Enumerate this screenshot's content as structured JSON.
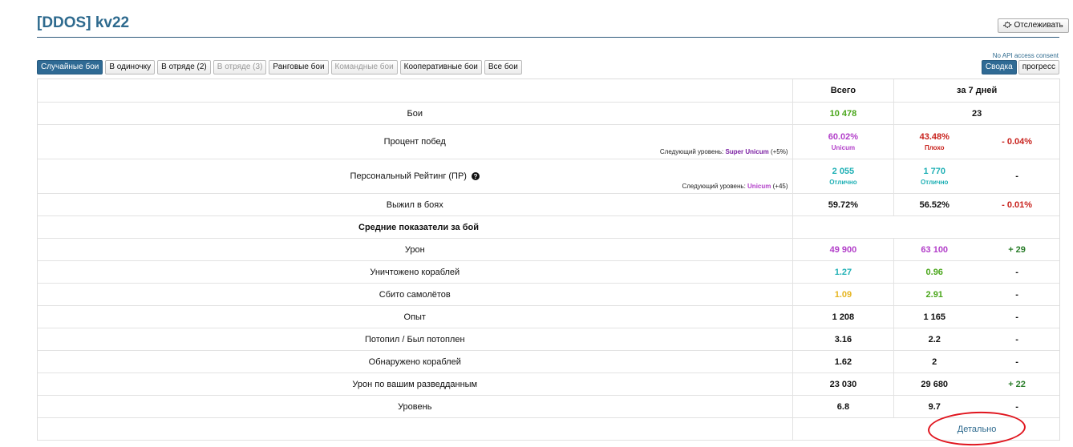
{
  "header": {
    "player_name": "[DDOS] kv22",
    "track_button": "Отслеживать",
    "api_note": "No API access consent"
  },
  "tabs": [
    {
      "label": "Случайные бои",
      "state": "active"
    },
    {
      "label": "В одиночку",
      "state": "normal"
    },
    {
      "label": "В отряде (2)",
      "state": "normal"
    },
    {
      "label": "В отряде (3)",
      "state": "disabled"
    },
    {
      "label": "Ранговые бои",
      "state": "normal"
    },
    {
      "label": "Командные бои",
      "state": "disabled"
    },
    {
      "label": "Кооперативные бои",
      "state": "normal"
    },
    {
      "label": "Все бои",
      "state": "normal"
    }
  ],
  "mode_tabs": [
    {
      "label": "Сводка",
      "state": "active"
    },
    {
      "label": "прогресс",
      "state": "normal"
    }
  ],
  "columns": {
    "total": "Всего",
    "week": "за 7 дней"
  },
  "colors": {
    "green": "#4aa61b",
    "purple": "#b23fc9",
    "red": "#c8221d",
    "teal": "#1fb0b5",
    "yellow": "#e6b520",
    "dark_green": "#2a7d2a",
    "link": "#2e6a8e",
    "dark_purple": "#7a1fa2"
  },
  "rows": [
    {
      "label": "Бои",
      "total": "10 478",
      "total_color": "#4aa61b",
      "week": "23",
      "week_color": "#111",
      "diff": "",
      "merged": true
    },
    {
      "label": "Процент побед",
      "total": "60.02%",
      "total_color": "#b23fc9",
      "total_sub": "Unicum",
      "week": "43.48%",
      "week_color": "#c8221d",
      "week_sub": "Плохо",
      "diff": "- 0.04%",
      "diff_color": "#c8221d",
      "next_prefix": "Следующий уровень:",
      "next_level": "Super Unicum",
      "next_level_color": "#7a1fa2",
      "next_suffix": "(+5%)",
      "tall": true
    },
    {
      "label": "Персональный Рейтинг (ПР)",
      "help": true,
      "total": "2 055",
      "total_color": "#1fb0b5",
      "total_sub": "Отлично",
      "week": "1 770",
      "week_color": "#1fb0b5",
      "week_sub": "Отлично",
      "diff": "-",
      "diff_color": "#111",
      "next_prefix": "Следующий уровень:",
      "next_level": "Unicum",
      "next_level_color": "#b23fc9",
      "next_suffix": "(+45)",
      "tall": true
    },
    {
      "label": "Выжил в боях",
      "total": "59.72%",
      "total_color": "#111",
      "week": "56.52%",
      "week_color": "#111",
      "diff": "- 0.01%",
      "diff_color": "#c8221d"
    },
    {
      "label": "Средние показатели за бой",
      "section": true
    },
    {
      "label": "Урон",
      "total": "49 900",
      "total_color": "#b23fc9",
      "week": "63 100",
      "week_color": "#b23fc9",
      "diff": "+ 29",
      "diff_color": "#2a7d2a"
    },
    {
      "label": "Уничтожено кораблей",
      "total": "1.27",
      "total_color": "#1fb0b5",
      "week": "0.96",
      "week_color": "#4aa61b",
      "diff": "-",
      "diff_color": "#111"
    },
    {
      "label": "Сбито самолётов",
      "total": "1.09",
      "total_color": "#e6b520",
      "week": "2.91",
      "week_color": "#4aa61b",
      "diff": "-",
      "diff_color": "#111"
    },
    {
      "label": "Опыт",
      "total": "1 208",
      "total_color": "#111",
      "week": "1 165",
      "week_color": "#111",
      "diff": "-",
      "diff_color": "#111"
    },
    {
      "label": "Потопил / Был потоплен",
      "total": "3.16",
      "total_color": "#111",
      "week": "2.2",
      "week_color": "#111",
      "diff": "-",
      "diff_color": "#111"
    },
    {
      "label": "Обнаружено кораблей",
      "total": "1.62",
      "total_color": "#111",
      "week": "2",
      "week_color": "#111",
      "diff": "-",
      "diff_color": "#111"
    },
    {
      "label": "Урон по вашим разведданным",
      "total": "23 030",
      "total_color": "#111",
      "week": "29 680",
      "week_color": "#111",
      "diff": "+ 22",
      "diff_color": "#2a7d2a"
    },
    {
      "label": "Уровень",
      "total": "6.8",
      "total_color": "#111",
      "week": "9.7",
      "week_color": "#111",
      "diff": "-",
      "diff_color": "#111"
    }
  ],
  "details_link": "Детально"
}
